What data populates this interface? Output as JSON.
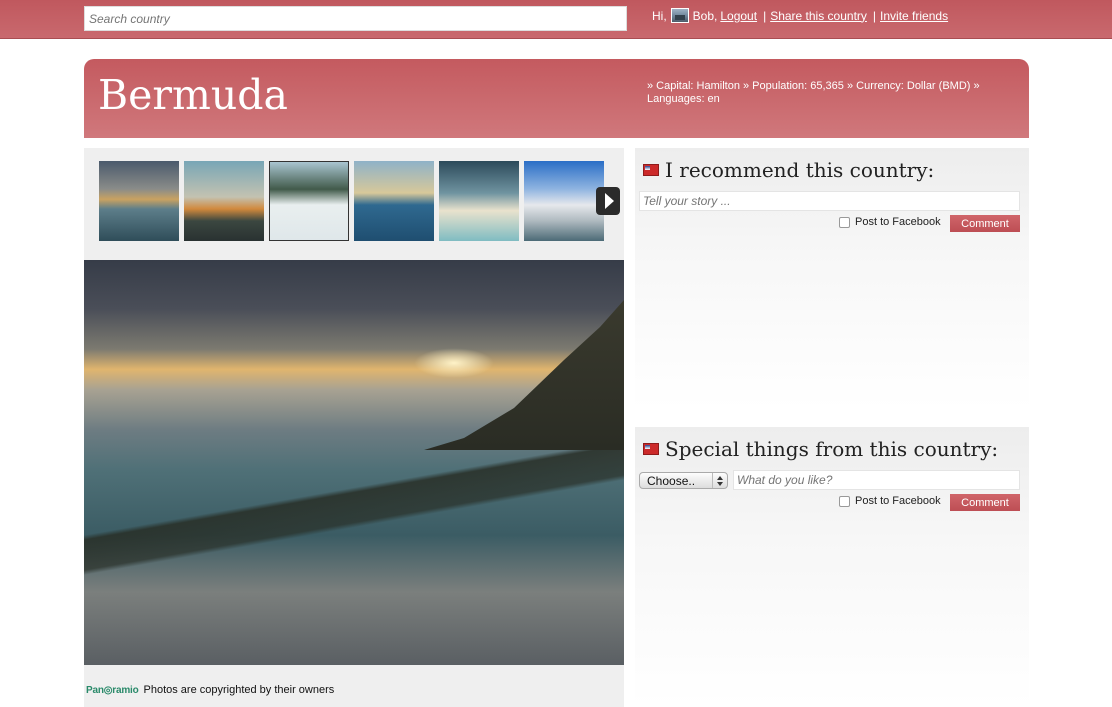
{
  "topbar": {
    "search_placeholder": "Search country",
    "greeting": "Hi,",
    "user_name": "Bob,",
    "logout_label": "Logout",
    "separator": "|",
    "share_label": "Share this country",
    "invite_label": "Invite friends"
  },
  "country": {
    "name": "Bermuda",
    "facts": "» Capital: Hamilton » Population: 65,365 » Currency: Dollar (BMD) » Languages: en"
  },
  "gallery": {
    "thumbnails": [
      {
        "name": "beach sunset"
      },
      {
        "name": "harbor boats"
      },
      {
        "name": "swimmer in white water"
      },
      {
        "name": "rainbow over sea"
      },
      {
        "name": "beach cove"
      },
      {
        "name": "hotel by the sea"
      }
    ],
    "next_icon": "play-right-icon",
    "footer_logo": "Pan◎ramio",
    "footer_text": "Photos are copyrighted by their owners"
  },
  "recommend_panel": {
    "title": "I recommend this country:",
    "story_placeholder": "Tell your story ...",
    "facebook_label": "Post to Facebook",
    "comment_label": "Comment"
  },
  "special_panel": {
    "title": "Special things from this country:",
    "select_value": "Choose..",
    "like_placeholder": "What do you like?",
    "facebook_label": "Post to Facebook",
    "comment_label": "Comment"
  },
  "colors": {
    "brand_red": "#c45a5f",
    "panel_grey": "#efefef",
    "button_red": "#bd4e54"
  }
}
